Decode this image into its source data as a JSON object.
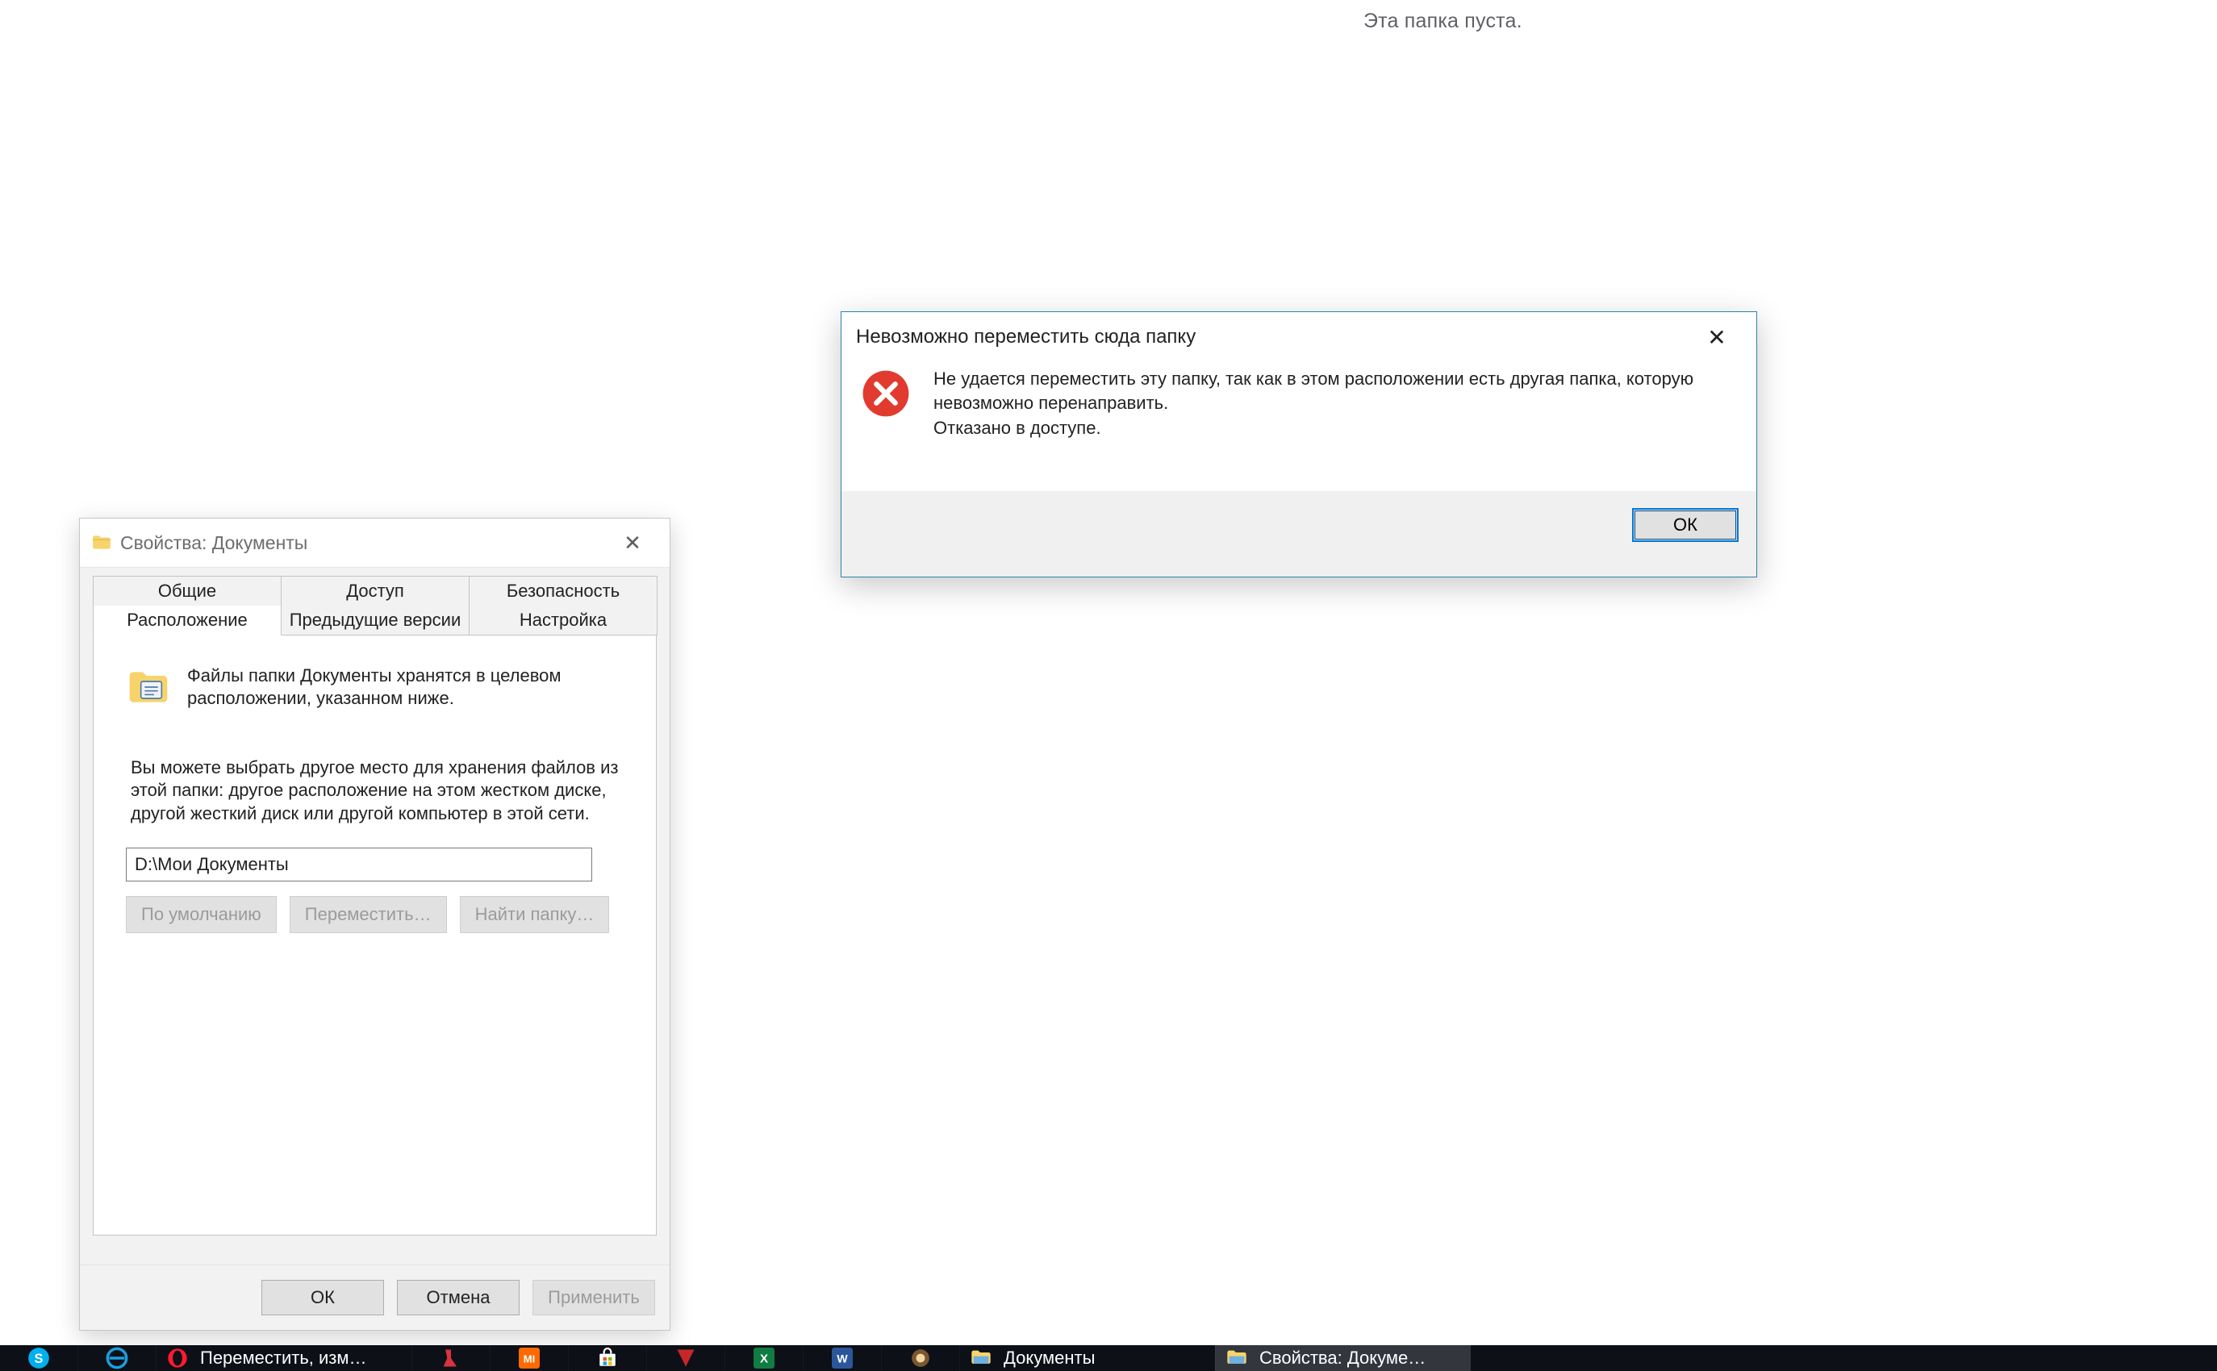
{
  "explorer_empty_message": "Эта папка пуста.",
  "props": {
    "title": "Свойства: Документы",
    "tabs_row1": [
      "Общие",
      "Доступ",
      "Безопасность"
    ],
    "tabs_row2": [
      "Расположение",
      "Предыдущие версии",
      "Настройка"
    ],
    "active_tab": "Расположение",
    "panel_desc": "Файлы папки Документы хранятся в целевом расположении, указанном ниже.",
    "panel_note": "Вы можете выбрать другое место для хранения файлов из этой папки: другое расположение на этом жестком диске, другой жесткий диск или другой компьютер в этой сети.",
    "path_value": "D:\\Мои Документы",
    "btn_restore": "По умолчанию",
    "btn_move": "Переместить…",
    "btn_find": "Найти папку…",
    "footer_ok": "ОК",
    "footer_cancel": "Отмена",
    "footer_apply": "Применить"
  },
  "error": {
    "title": "Невозможно переместить сюда папку",
    "line1": "Не удается переместить эту папку, так как в этом расположении есть другая папка, которую невозможно перенаправить.",
    "line2": "Отказано в доступе.",
    "ok": "ОК"
  },
  "taskbar": {
    "items": [
      {
        "name": "skype",
        "label": "",
        "wide": false
      },
      {
        "name": "edge",
        "label": "",
        "wide": false
      },
      {
        "name": "opera",
        "label": "Переместить, изм…",
        "wide": true
      },
      {
        "name": "ccleaner",
        "label": "",
        "wide": false
      },
      {
        "name": "mi",
        "label": "",
        "wide": false
      },
      {
        "name": "store",
        "label": "",
        "wide": false
      },
      {
        "name": "gimp",
        "label": "",
        "wide": false
      },
      {
        "name": "excel",
        "label": "",
        "wide": false
      },
      {
        "name": "word",
        "label": "",
        "wide": false
      },
      {
        "name": "app",
        "label": "",
        "wide": false
      },
      {
        "name": "explorer1",
        "label": "Документы",
        "wide": true
      },
      {
        "name": "explorer2",
        "label": "Свойства: Докуме…",
        "wide": true,
        "active": true
      }
    ]
  }
}
